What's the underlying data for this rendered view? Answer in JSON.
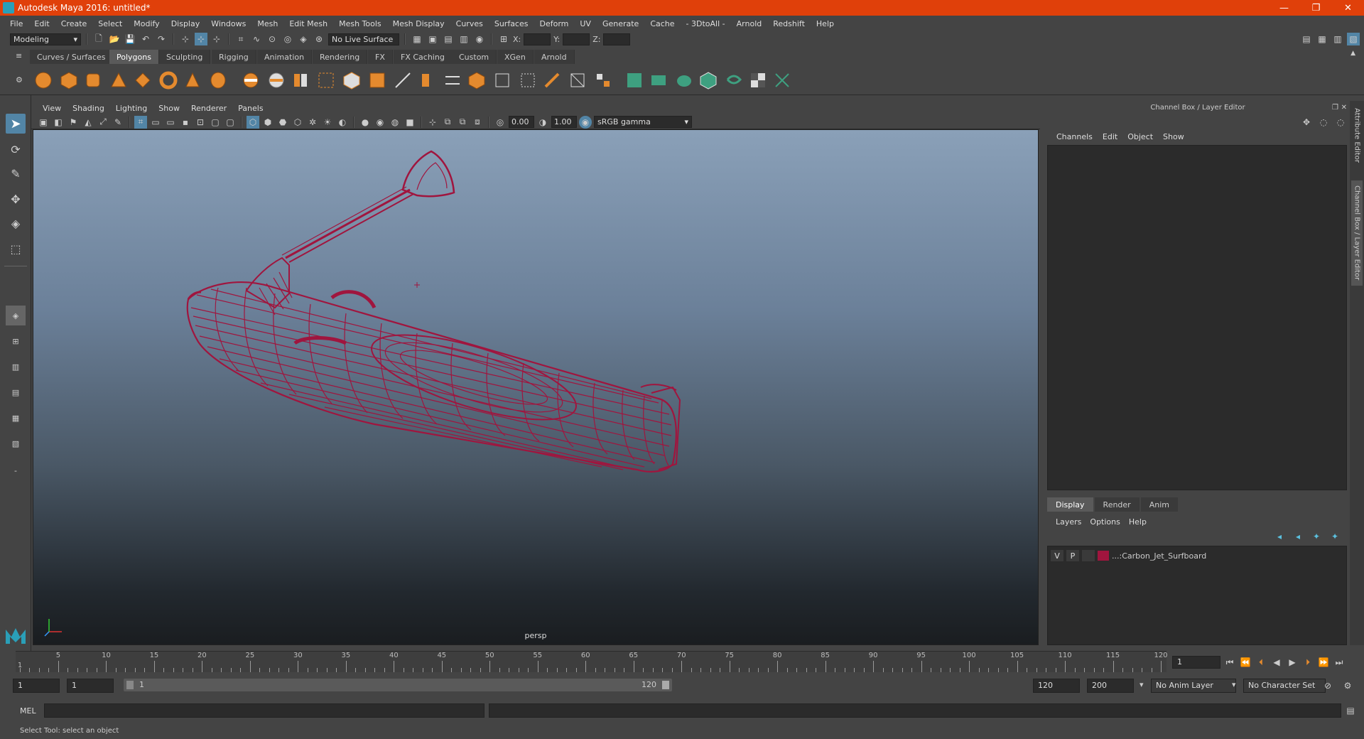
{
  "window": {
    "title": "Autodesk Maya 2016: untitled*",
    "controls": [
      "—",
      "❐",
      "✕"
    ]
  },
  "menubar": [
    "File",
    "Edit",
    "Create",
    "Select",
    "Modify",
    "Display",
    "Windows",
    "Mesh",
    "Edit Mesh",
    "Mesh Tools",
    "Mesh Display",
    "Curves",
    "Surfaces",
    "Deform",
    "UV",
    "Generate",
    "Cache",
    "- 3DtoAll -",
    "Arnold",
    "Redshift",
    "Help"
  ],
  "statusline": {
    "mode": "Modeling",
    "live_surface": "No Live Surface",
    "x_label": "X:",
    "y_label": "Y:",
    "z_label": "Z:"
  },
  "shelf_tabs": [
    "Curves / Surfaces",
    "Polygons",
    "Sculpting",
    "Rigging",
    "Animation",
    "Rendering",
    "FX",
    "FX Caching",
    "Custom",
    "XGen",
    "Arnold"
  ],
  "shelf_active": "Polygons",
  "viewport": {
    "menu": [
      "View",
      "Shading",
      "Lighting",
      "Show",
      "Renderer",
      "Panels"
    ],
    "exposure": "0.00",
    "gamma": "1.00",
    "color_space": "sRGB gamma",
    "camera_label": "persp"
  },
  "channel_box": {
    "title": "Channel Box / Layer Editor",
    "menu": [
      "Channels",
      "Edit",
      "Object",
      "Show"
    ]
  },
  "layer_editor": {
    "tabs": [
      "Display",
      "Render",
      "Anim"
    ],
    "active_tab": "Display",
    "menu": [
      "Layers",
      "Options",
      "Help"
    ],
    "layer": {
      "v": "V",
      "p": "P",
      "name": "...:Carbon_Jet_Surfboard",
      "color": "#a0153e"
    }
  },
  "side_tabs": [
    "Attribute Editor",
    "Channel Box / Layer Editor"
  ],
  "timeline": {
    "labels": [
      "5",
      "10",
      "15",
      "20",
      "25",
      "30",
      "35",
      "40",
      "45",
      "50",
      "55",
      "60",
      "65",
      "70",
      "75",
      "80",
      "85",
      "90",
      "95",
      "100",
      "105",
      "110",
      "115",
      "120"
    ],
    "start_label": "1",
    "current_frame": "1"
  },
  "range": {
    "start": "1",
    "playback_start": "1",
    "slider_start": "1",
    "slider_end": "120",
    "playback_end": "120",
    "end": "200",
    "anim_layer": "No Anim Layer",
    "character_set": "No Character Set"
  },
  "command": {
    "label": "MEL"
  },
  "help_line": "Select Tool: select an object",
  "colors": {
    "wireframe": "#a0153e",
    "titlebar": "#e0400a",
    "selected_tool": "#5285a6"
  }
}
